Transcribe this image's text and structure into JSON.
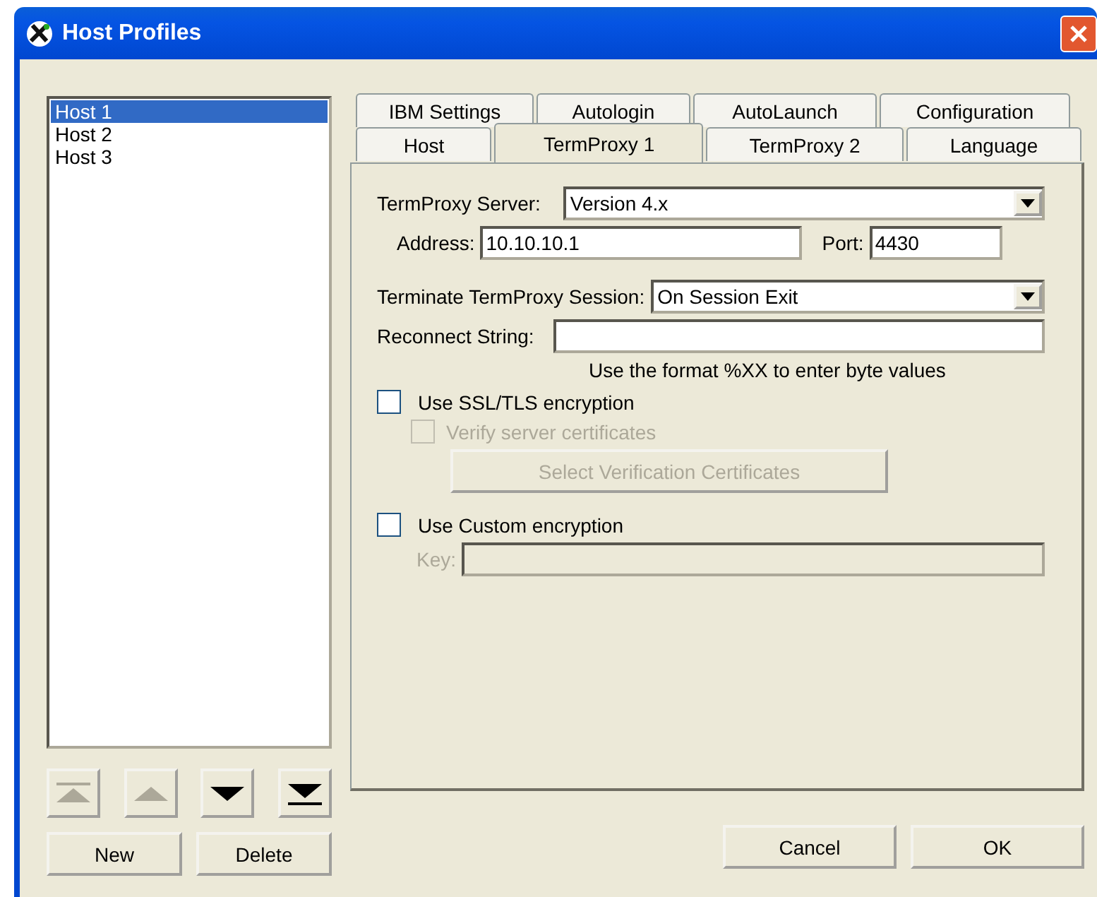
{
  "window": {
    "title": "Host Profiles"
  },
  "hosts": [
    {
      "label": "Host 1",
      "selected": true
    },
    {
      "label": "Host 2",
      "selected": false
    },
    {
      "label": "Host 3",
      "selected": false
    }
  ],
  "move_buttons": [
    {
      "kind": "top",
      "disabled": true
    },
    {
      "kind": "up",
      "disabled": true
    },
    {
      "kind": "down",
      "disabled": false
    },
    {
      "kind": "bottom",
      "disabled": false
    }
  ],
  "list_buttons": [
    "New",
    "Delete"
  ],
  "tab_rows": [
    [
      {
        "label": "IBM Settings",
        "selected": false
      },
      {
        "label": "Autologin",
        "selected": false
      },
      {
        "label": "AutoLaunch",
        "selected": false
      },
      {
        "label": "Configuration",
        "selected": false
      }
    ],
    [
      {
        "label": "Host",
        "selected": false
      },
      {
        "label": "TermProxy 1",
        "selected": true
      },
      {
        "label": "TermProxy 2",
        "selected": false
      },
      {
        "label": "Language",
        "selected": false
      }
    ]
  ],
  "server": {
    "label": "TermProxy Server:",
    "value": "Version 4.x"
  },
  "address": {
    "label": "Address:",
    "value": "10.10.10.1"
  },
  "port": {
    "label": "Port:",
    "value": "4430"
  },
  "terminate": {
    "label": "Terminate TermProxy Session:",
    "value": "On Session Exit"
  },
  "reconnect": {
    "label": "Reconnect String:",
    "hint": "Use the format %XX to enter byte values"
  },
  "ssl": {
    "label": "Use SSL/TLS encryption",
    "checked": false,
    "disabled": false
  },
  "verify": {
    "label": "Verify server certificates",
    "checked": false,
    "disabled": true
  },
  "select_certs": {
    "label": "Select Verification Certificates",
    "disabled": true
  },
  "custom": {
    "label": "Use Custom encryption",
    "checked": false,
    "disabled": false
  },
  "key": {
    "label": "Key:",
    "disabled": true
  },
  "dialog_buttons": [
    "Cancel",
    "OK"
  ]
}
